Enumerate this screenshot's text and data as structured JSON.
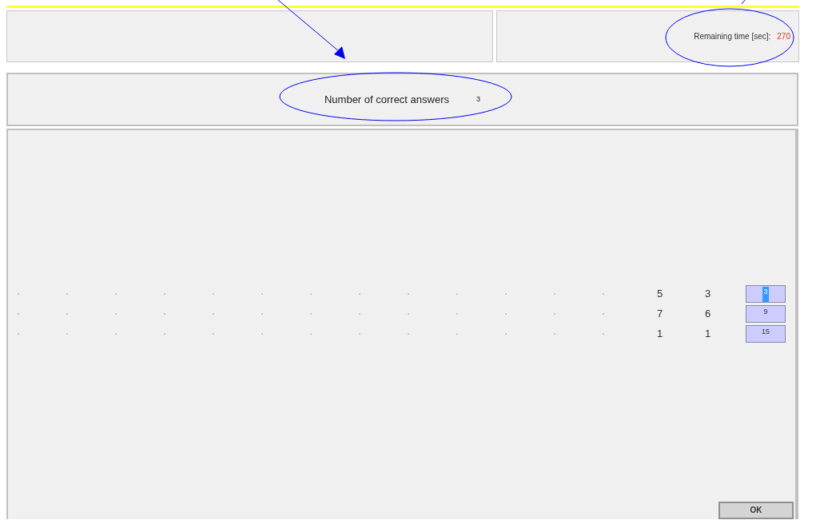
{
  "timer": {
    "label": "Remaining time [sec]:",
    "value": "270"
  },
  "score": {
    "label": "Number of correct answers",
    "value": "3"
  },
  "rows": [
    {
      "first": "5",
      "second": "3",
      "answer": "3",
      "focused": true
    },
    {
      "first": "7",
      "second": "6",
      "answer": "9",
      "focused": false
    },
    {
      "first": "1",
      "second": "1",
      "answer": "15",
      "focused": false
    }
  ],
  "ok_button": "OK"
}
